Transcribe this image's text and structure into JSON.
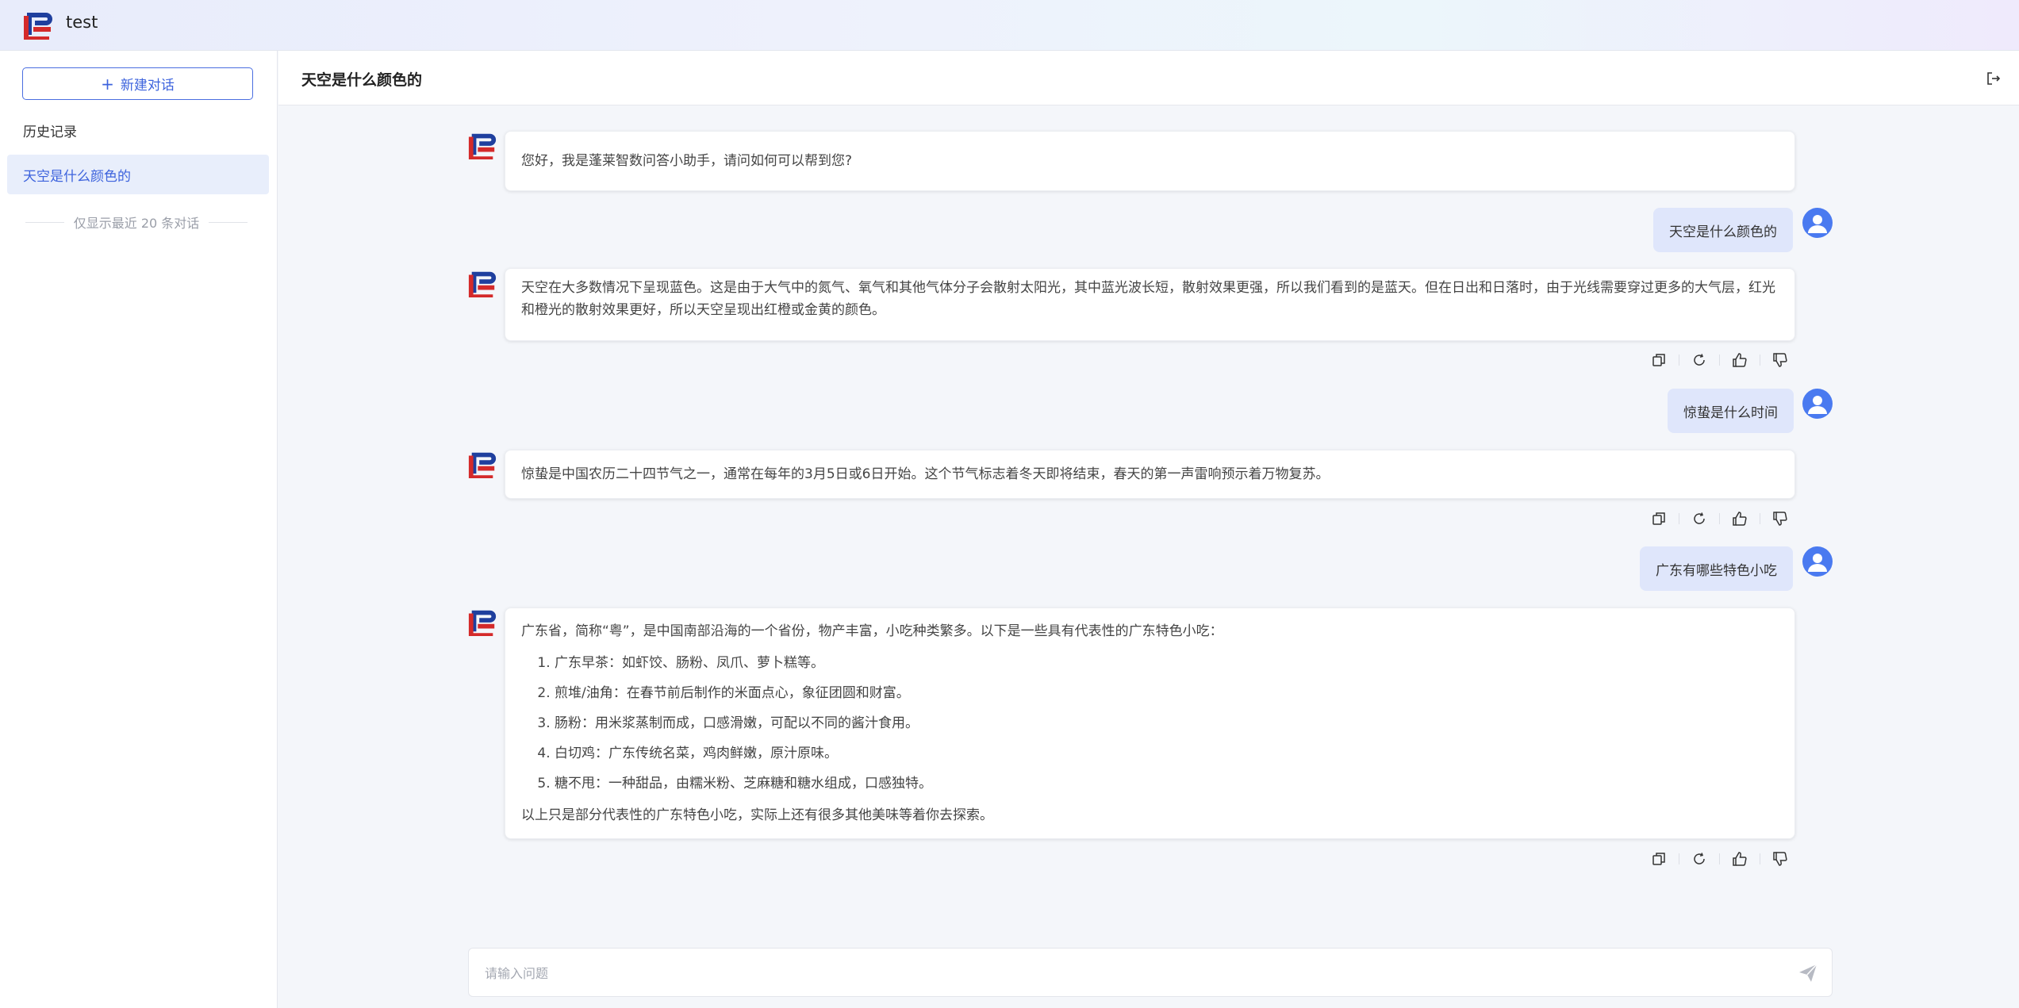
{
  "app": {
    "title": "test"
  },
  "sidebar": {
    "new_chat_label": "新建对话",
    "history_heading": "历史记录",
    "history_items": [
      {
        "label": "天空是什么颜色的"
      }
    ],
    "history_note": "仅显示最近 20 条对话"
  },
  "header": {
    "title": "天空是什么颜色的"
  },
  "messages": [
    {
      "role": "bot",
      "text": "您好，我是蓬莱智数问答小助手，请问如何可以帮到您?"
    },
    {
      "role": "user",
      "text": "天空是什么颜色的"
    },
    {
      "role": "bot",
      "text": "天空在大多数情况下呈现蓝色。这是由于大气中的氮气、氧气和其他气体分子会散射太阳光，其中蓝光波长短，散射效果更强，所以我们看到的是蓝天。但在日出和日落时，由于光线需要穿过更多的大气层，红光和橙光的散射效果更好，所以天空呈现出红橙或金黄的颜色。"
    },
    {
      "role": "user",
      "text": "惊蛰是什么时间"
    },
    {
      "role": "bot",
      "text": "惊蛰是中国农历二十四节气之一，通常在每年的3月5日或6日开始。这个节气标志着冬天即将结束，春天的第一声雷响预示着万物复苏。"
    },
    {
      "role": "user",
      "text": "广东有哪些特色小吃"
    },
    {
      "role": "bot",
      "intro": "广东省，简称“粤”，是中国南部沿海的一个省份，物产丰富，小吃种类繁多。以下是一些具有代表性的广东特色小吃：",
      "list": [
        "广东早茶：如虾饺、肠粉、凤爪、萝卜糕等。",
        "煎堆/油角：在春节前后制作的米面点心，象征团圆和财富。",
        "肠粉：用米浆蒸制而成，口感滑嫩，可配以不同的酱汁食用。",
        "白切鸡：广东传统名菜，鸡肉鲜嫩，原汁原味。",
        "糖不甩：一种甜品，由糯米粉、芝麻糖和糖水组成，口感独特。"
      ],
      "outro": "以上只是部分代表性的广东特色小吃，实际上还有很多其他美味等着你去探索。"
    }
  ],
  "input": {
    "placeholder": "请输入问题",
    "value": ""
  },
  "icons": {
    "copy": "copy-icon",
    "regenerate": "refresh-icon",
    "like": "thumbs-up-icon",
    "dislike": "thumbs-down-icon",
    "send": "send-icon",
    "exit": "logout-icon",
    "logo": "brand-logo-icon"
  },
  "colors": {
    "accent": "#3d63dd",
    "logo_red": "#d42a2a",
    "logo_blue": "#1f3f9e",
    "user_bubble": "#dfe6fb",
    "avatar": "#4a7af0"
  }
}
